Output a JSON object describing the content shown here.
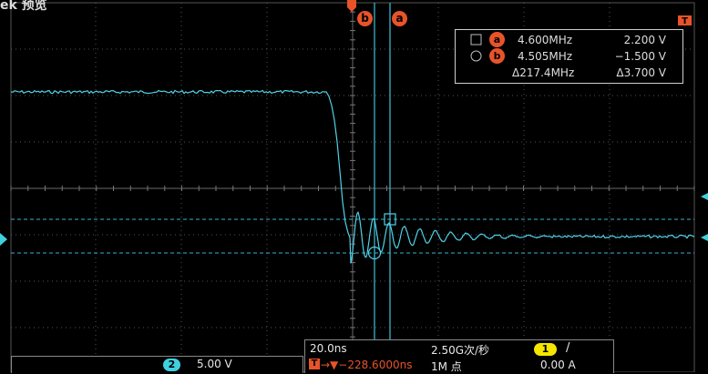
{
  "header": {
    "title": "ek 预览"
  },
  "cursors": {
    "a_label": "a",
    "b_label": "b",
    "t_label": "T"
  },
  "measurement": {
    "row_a": {
      "marker": "a",
      "freq": "4.600MHz",
      "volt": "2.200 V"
    },
    "row_b": {
      "marker": "b",
      "freq": "4.505MHz",
      "volt": "−1.500 V"
    },
    "delta": {
      "freq": "Δ217.4MHz",
      "volt": "Δ3.700 V"
    }
  },
  "status": {
    "timebase": "20.0ns",
    "sample_rate": "2.50G次/秒",
    "trigger_channel": "1",
    "trigger_slope": "/",
    "trigger_position": "→▼−228.6000ns",
    "record_length": "1M 点",
    "trigger_level": "0.00 A"
  },
  "channel2": {
    "number": "2",
    "scale": "5.00 V"
  },
  "colors": {
    "trace": "#4fd2e6",
    "cursor": "#39b3cc",
    "accent": "#e8532a",
    "grid": "#5a5a5a",
    "badge_yellow": "#f5e600",
    "badge_cyan": "#3fd0e0"
  }
}
